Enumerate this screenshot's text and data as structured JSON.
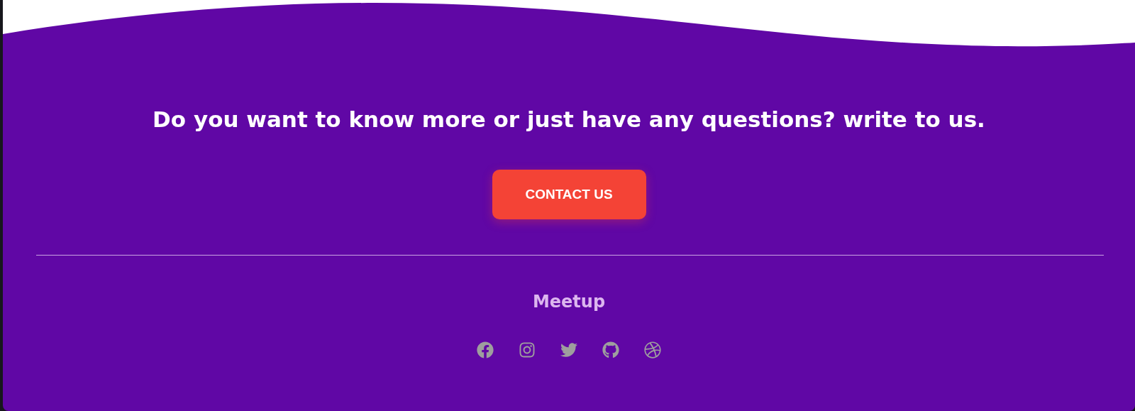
{
  "cta": {
    "heading": "Do you want to know more or just have any questions? write to us.",
    "button": "CONTACT US"
  },
  "footer": {
    "brand": "Meetup",
    "social_links": [
      {
        "kind": "facebook"
      },
      {
        "kind": "instagram"
      },
      {
        "kind": "twitter"
      },
      {
        "kind": "github"
      },
      {
        "kind": "dribbble"
      }
    ]
  }
}
